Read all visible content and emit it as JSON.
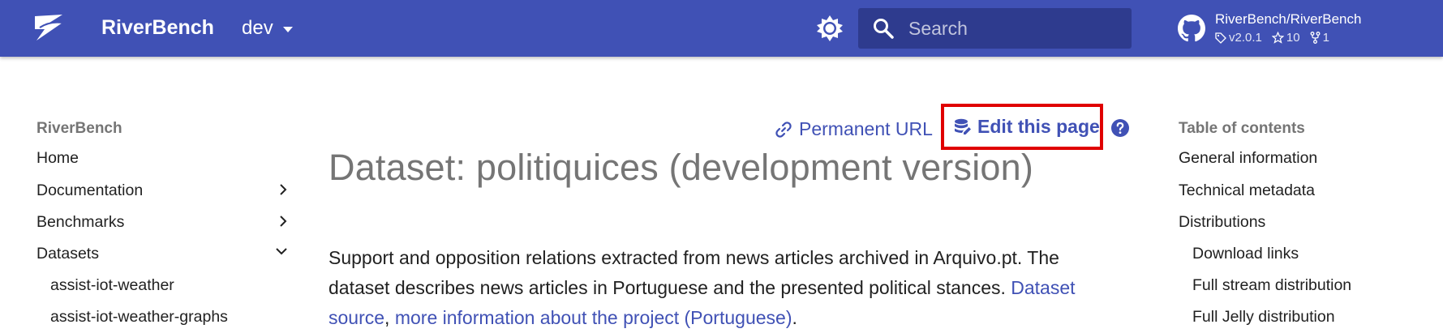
{
  "header": {
    "site_name": "RiverBench",
    "version_label": "dev",
    "search_placeholder": "Search",
    "repo_name": "RiverBench/RiverBench",
    "repo_version": "v2.0.1",
    "repo_stars": "10",
    "repo_forks": "1",
    "brand_color": "#4051b5"
  },
  "nav": {
    "title": "RiverBench",
    "items": [
      {
        "label": "Home"
      },
      {
        "label": "Documentation",
        "expand": "chevron-right-icon"
      },
      {
        "label": "Benchmarks",
        "expand": "chevron-right-icon"
      },
      {
        "label": "Datasets",
        "expand": "chevron-down-icon"
      },
      {
        "label": "assist-iot-weather"
      },
      {
        "label": "assist-iot-weather-graphs"
      }
    ]
  },
  "actions": {
    "permanent_url": "Permanent URL",
    "edit_page": "Edit this page"
  },
  "main": {
    "title": "Dataset: politiquices (development version)",
    "desc_text": "Support and opposition relations extracted from news articles archived in Arquivo.pt. The dataset describes news articles in Portuguese and the presented political stances. ",
    "link1": "Dataset source",
    "sep": ", ",
    "link2": "more information about the project (Portuguese)",
    "end": "."
  },
  "toc": {
    "title": "Table of contents",
    "items": [
      {
        "label": "General information"
      },
      {
        "label": "Technical metadata"
      },
      {
        "label": "Distributions"
      },
      {
        "label": "Download links"
      },
      {
        "label": "Full stream distribution"
      },
      {
        "label": "Full Jelly distribution"
      }
    ]
  }
}
